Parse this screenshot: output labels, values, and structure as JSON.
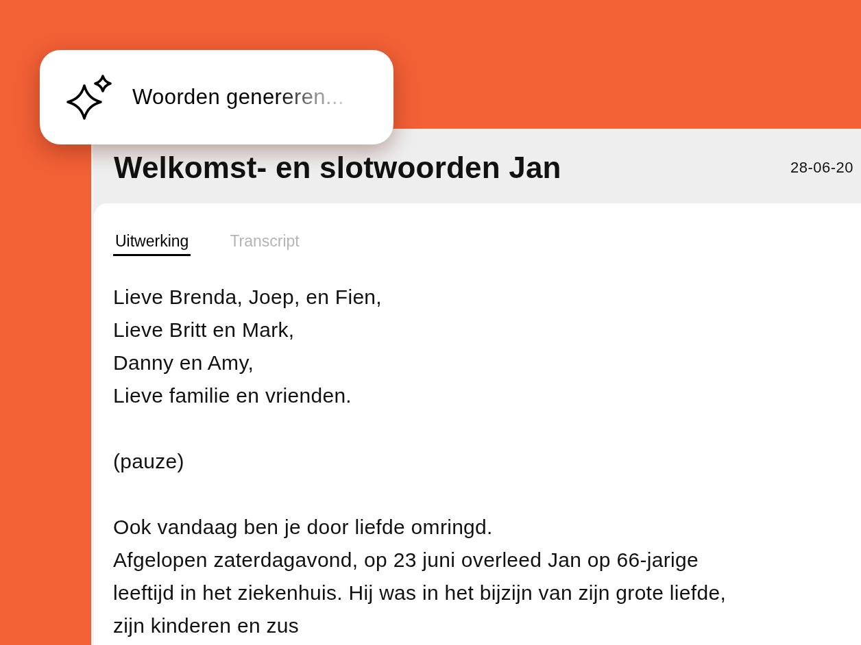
{
  "toast": {
    "message": "Woorden genereren..."
  },
  "document": {
    "title": "Welkomst- en slotwoorden Jan",
    "date": "28-06-20"
  },
  "tabs": [
    {
      "label": "Uitwerking",
      "selected": true
    },
    {
      "label": "Transcript",
      "selected": false
    }
  ],
  "content": [
    {
      "lines": [
        "Lieve Brenda, Joep, en Fien,",
        "Lieve Britt en Mark,",
        "Danny en Amy,",
        "Lieve familie en vrienden."
      ]
    },
    {
      "lines": [
        "(pauze)"
      ]
    },
    {
      "lines": [
        "Ook vandaag ben je door liefde omringd.",
        "Afgelopen zaterdagavond, op 23 juni overleed Jan op 66-jarige leeftijd in het ziekenhuis. Hij was in het bijzijn van zijn grote liefde, zijn kinderen en zus"
      ]
    }
  ]
}
